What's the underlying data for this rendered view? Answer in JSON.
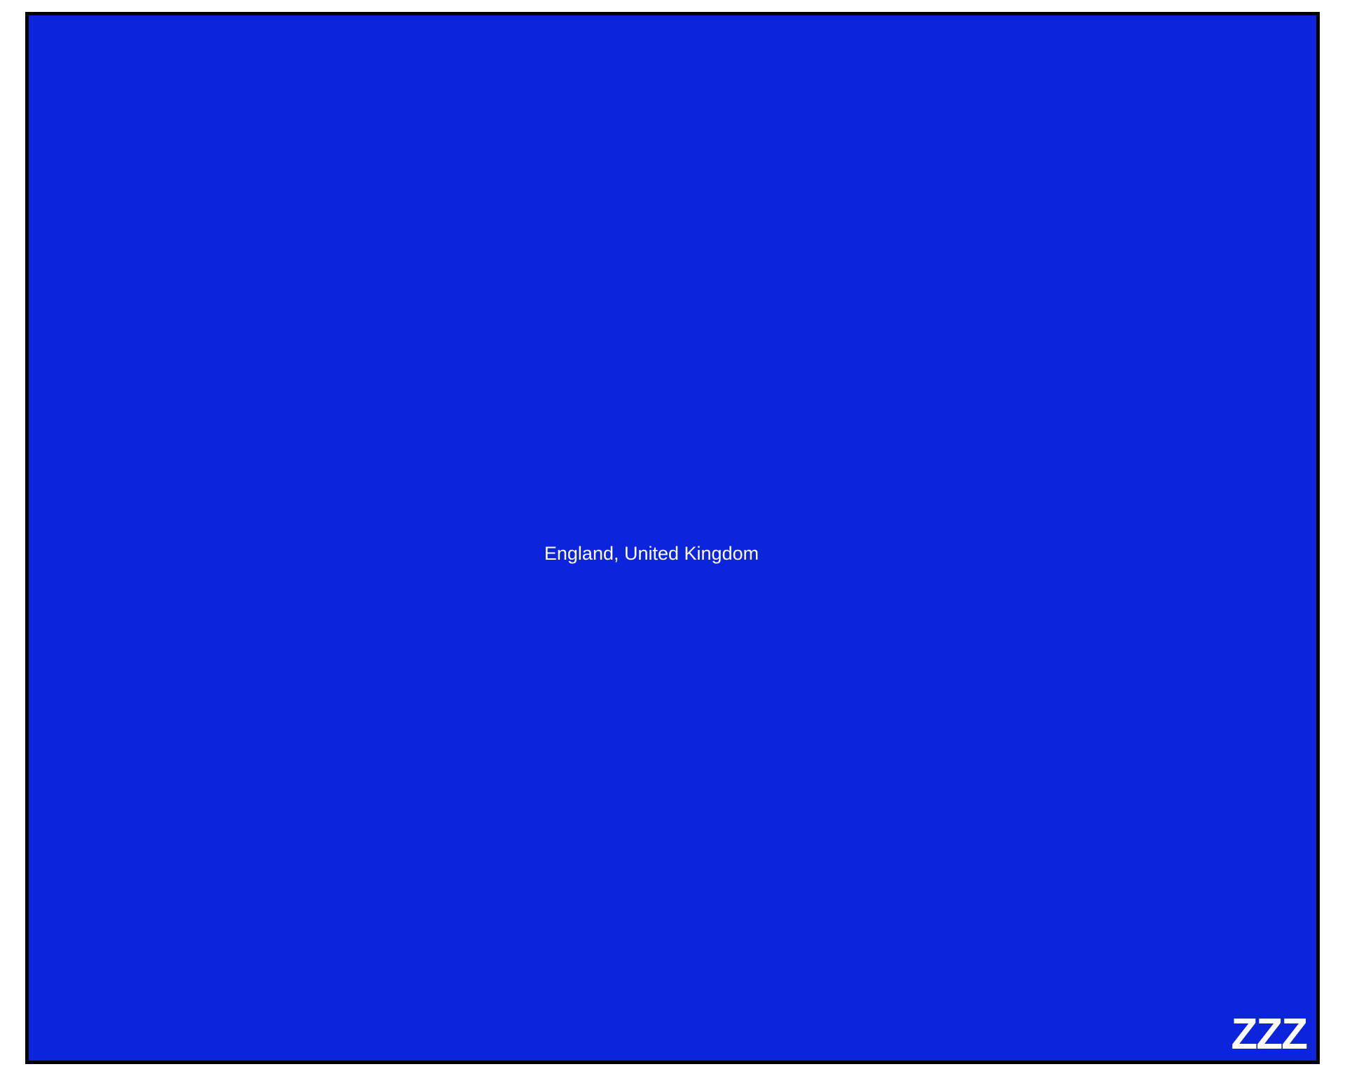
{
  "map": {
    "location_label": "England, United Kingdom",
    "brand_mark": "ZZZ",
    "colors": {
      "background": "#0c24db",
      "border": "#000000",
      "text": "#ffffff"
    }
  }
}
